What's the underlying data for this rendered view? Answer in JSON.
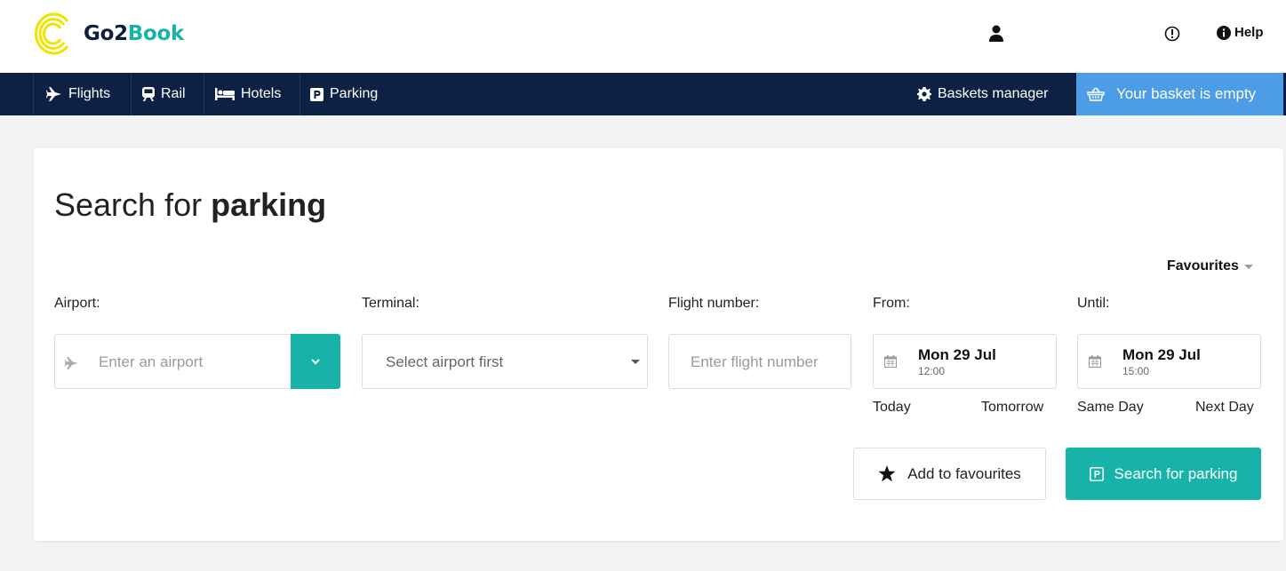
{
  "brand": {
    "go2": "Go2",
    "book": "Book"
  },
  "topbar": {
    "help_label": "Help"
  },
  "nav": {
    "items": [
      {
        "label": "Flights",
        "icon": "plane-icon"
      },
      {
        "label": "Rail",
        "icon": "train-icon"
      },
      {
        "label": "Hotels",
        "icon": "bed-icon"
      },
      {
        "label": "Parking",
        "icon": "parking-icon"
      }
    ],
    "baskets_manager": "Baskets manager",
    "basket_status": "Your basket is empty"
  },
  "page": {
    "title_prefix": "Search for",
    "title_bold": "parking",
    "favourites_label": "Favourites"
  },
  "form": {
    "airport": {
      "label": "Airport:",
      "placeholder": "Enter an airport"
    },
    "terminal": {
      "label": "Terminal:",
      "value": "Select airport first"
    },
    "flight": {
      "label": "Flight number:",
      "placeholder": "Enter flight number"
    },
    "from": {
      "label": "From:",
      "date": "Mon 29 Jul",
      "time": "12:00",
      "quick1": "Today",
      "quick2": "Tomorrow"
    },
    "until": {
      "label": "Until:",
      "date": "Mon 29 Jul",
      "time": "15:00",
      "quick1": "Same Day",
      "quick2": "Next Day"
    }
  },
  "actions": {
    "add_favourites": "Add to favourites",
    "search": "Search for parking"
  },
  "colors": {
    "teal": "#18b3a8",
    "navy": "#0d2145",
    "basket_blue": "#4c9ce6",
    "logo_yellow": "#f2e200"
  }
}
